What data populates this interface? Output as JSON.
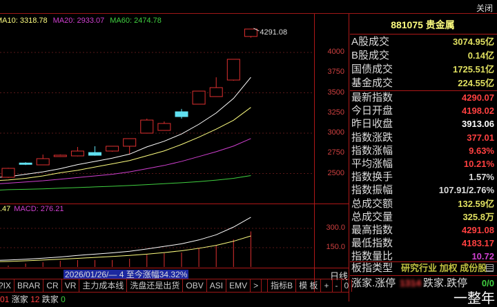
{
  "topbar": {
    "close_label": "关闭"
  },
  "legend": {
    "ma10": "MA10: 3318.78",
    "ma20": "MA20: 2933.07",
    "ma60": "MA60: 2474.78",
    "macd_left": ".47",
    "macd": "MACD: 276.21"
  },
  "colors": {
    "up": "#e03030",
    "down": "#60e0f0",
    "ma5": "#ffffff",
    "ma10": "#ffff80",
    "ma20": "#d040d0",
    "ma60": "#40d040"
  },
  "price_axis": {
    "ticks": [
      "4000",
      "3750",
      "3500",
      "3250",
      "3000",
      "2750",
      "2500"
    ],
    "high_label": "4291.08"
  },
  "macd_axis": {
    "ticks": [
      "300.0",
      "150.0"
    ]
  },
  "chart_data": {
    "type": "candlestick",
    "ylim": [
      2250,
      4350
    ],
    "candles": [
      {
        "o": 2453,
        "c": 2564,
        "h": 2570,
        "l": 2445
      },
      {
        "o": 2630,
        "c": 2618,
        "h": 2640,
        "l": 2605
      },
      {
        "o": 2607,
        "c": 2684,
        "h": 2735,
        "l": 2605
      },
      {
        "o": 2710,
        "c": 2727,
        "h": 2735,
        "l": 2705
      },
      {
        "o": 2718,
        "c": 2778,
        "h": 2829,
        "l": 2712
      },
      {
        "o": 2760,
        "c": 2726,
        "h": 2838,
        "l": 2720
      },
      {
        "o": 2778,
        "c": 2838,
        "h": 2840,
        "l": 2770
      },
      {
        "o": 2838,
        "c": 2932,
        "h": 2935,
        "l": 2744
      },
      {
        "o": 3000,
        "c": 3162,
        "h": 3180,
        "l": 2995
      },
      {
        "o": 3034,
        "c": 3120,
        "h": 3145,
        "l": 3030
      },
      {
        "o": 3265,
        "c": 3205,
        "h": 3300,
        "l": 3180
      },
      {
        "o": 3359,
        "c": 3521,
        "h": 3525,
        "l": 3355
      },
      {
        "o": 3453,
        "c": 3564,
        "h": 3692,
        "l": 3450
      },
      {
        "o": 3658,
        "c": 3915,
        "h": 3918,
        "l": 3650
      },
      {
        "o": 4198,
        "c": 4290,
        "h": 4291.08,
        "l": 4183
      }
    ],
    "ma5": [
      2460,
      2490,
      2520,
      2560,
      2610,
      2650,
      2690,
      2740,
      2830,
      2900,
      2990,
      3110,
      3250,
      3430,
      3692
    ],
    "ma10": [
      2420,
      2440,
      2470,
      2510,
      2540,
      2580,
      2620,
      2660,
      2720,
      2780,
      2860,
      2950,
      3050,
      3160,
      3318.78
    ],
    "ma20": [
      2380,
      2395,
      2410,
      2430,
      2450,
      2470,
      2490,
      2520,
      2560,
      2600,
      2650,
      2710,
      2770,
      2840,
      2933.07
    ],
    "ma60": [
      2300,
      2305,
      2310,
      2318,
      2326,
      2334,
      2342,
      2352,
      2362,
      2374,
      2386,
      2400,
      2418,
      2440,
      2474.78
    ],
    "macd_ylim": [
      0,
      450
    ],
    "macd_hist": [
      11,
      27,
      37,
      48,
      54,
      54,
      54,
      64,
      96,
      107,
      112,
      150,
      166,
      214,
      276.21
    ],
    "dif": [
      54,
      60,
      68,
      78,
      90,
      100,
      110,
      122,
      140,
      160,
      180,
      210,
      250,
      310,
      386
    ],
    "dea": [
      43,
      48,
      54,
      60,
      67,
      74,
      82,
      90,
      100,
      112,
      126,
      145,
      168,
      200,
      241
    ]
  },
  "date_bar": "2026/01/26/— 4 至今涨幅34.32%",
  "period_label": "日线",
  "tabs": [
    "?IX",
    "BRAR",
    "CR",
    "VR",
    "主力成本线",
    "洗盘还是出货",
    "OBV",
    "ASI",
    "EMV",
    ">",
    "",
    "指标B",
    "模 板",
    "+",
    "-",
    "0"
  ],
  "status": {
    "prefix": "01",
    "up_label": "涨家",
    "up_count": "12",
    "down_label": "跌家",
    "down_count": "0"
  },
  "panel": {
    "title": "881075 贵金属",
    "market": [
      {
        "label": "A股成交",
        "value": "3074.95亿"
      },
      {
        "label": "B股成交",
        "value": "0.14亿"
      },
      {
        "label": "国债成交",
        "value": "1725.51亿"
      },
      {
        "label": "基金成交",
        "value": "224.55亿"
      }
    ],
    "stats": [
      {
        "label": "最新指数",
        "value": "4290.07",
        "color": "#ff4040"
      },
      {
        "label": "今日开盘",
        "value": "4198.02",
        "color": "#ff4040"
      },
      {
        "label": "昨日收盘",
        "value": "3913.06",
        "color": "#ffffff"
      },
      {
        "label": "指数涨跌",
        "value": "377.01",
        "color": "#ff4040"
      },
      {
        "label": "指数涨幅",
        "value": "9.63%",
        "color": "#ff4040"
      },
      {
        "label": "平均涨幅",
        "value": "10.21%",
        "color": "#ff4040"
      },
      {
        "label": "指数换手",
        "value": "1.57%",
        "color": "#dddddd"
      },
      {
        "label": "指数振幅",
        "value": "107.91/2.76%",
        "color": "#dddddd"
      },
      {
        "label": "总成交额",
        "value": "132.59亿",
        "color": "#e0e060"
      },
      {
        "label": "总成交量",
        "value": "325.8万",
        "color": "#e0e060"
      },
      {
        "label": "最高指数",
        "value": "4291.08",
        "color": "#ff4040"
      },
      {
        "label": "最低指数",
        "value": "4183.17",
        "color": "#ff4040"
      },
      {
        "label": "指数量比",
        "value": "10.72",
        "color": "#d040d0"
      }
    ],
    "type_label": "板指类型",
    "type_value": "研究行业 加权 成份股",
    "limit_label": "涨家.涨停",
    "limit_up": "1314",
    "limit_down_label": "跌家.跌停",
    "limit_down": "0/0"
  },
  "watermark": "一整年"
}
